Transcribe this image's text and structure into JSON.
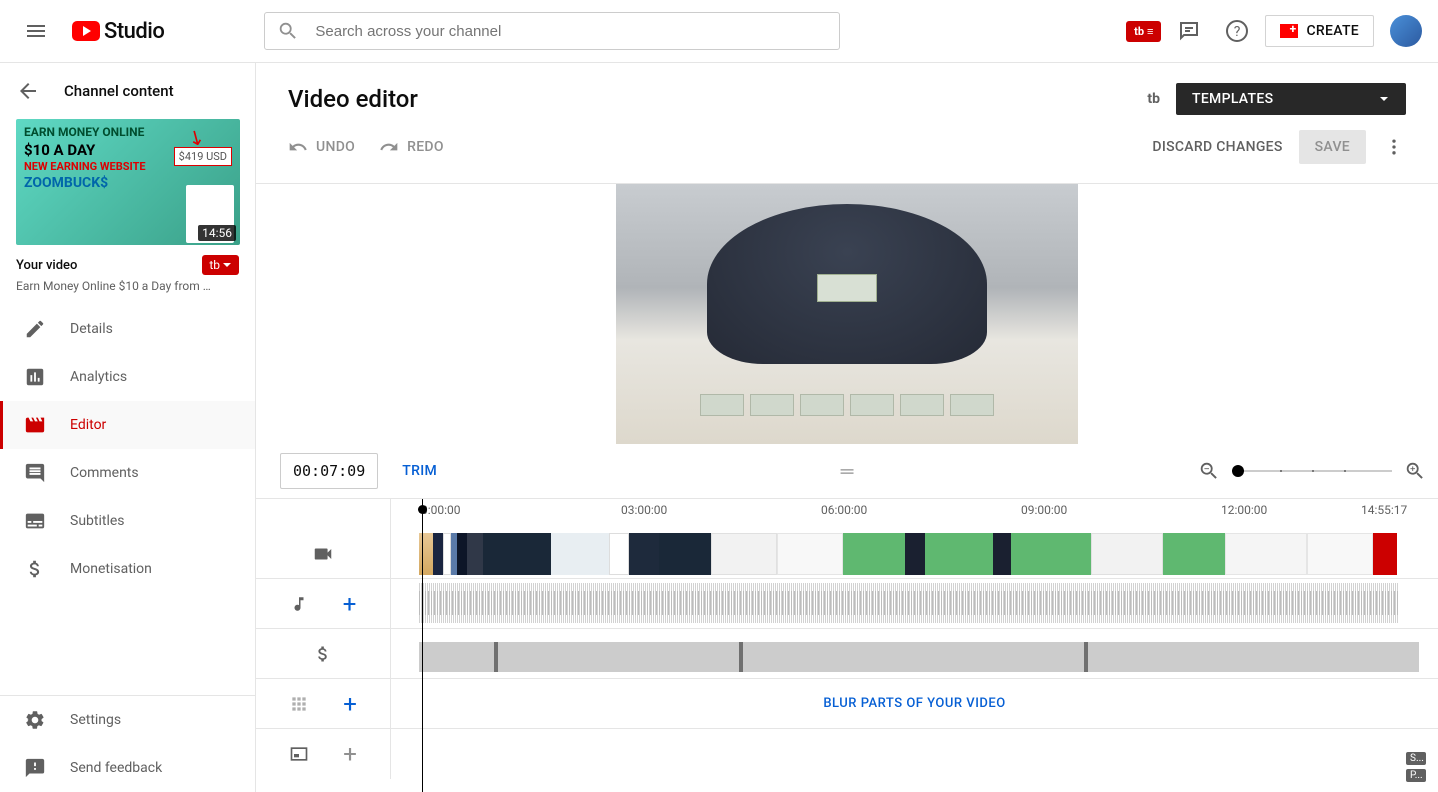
{
  "header": {
    "logo_text": "Studio",
    "search_placeholder": "Search across your channel",
    "create_label": "CREATE"
  },
  "sidebar": {
    "back_label": "Channel content",
    "thumb": {
      "line1": "EARN MONEY ONLINE",
      "line2": "$10 A DAY",
      "line3": "NEW EARNING WEBSITE",
      "line4": "ZOOMBUCK$",
      "price": "$419 USD",
      "duration": "14:56"
    },
    "video_title": "Your video",
    "video_subtitle": "Earn Money Online $10 a Day from …",
    "nav": [
      {
        "label": "Details"
      },
      {
        "label": "Analytics"
      },
      {
        "label": "Editor"
      },
      {
        "label": "Comments"
      },
      {
        "label": "Subtitles"
      },
      {
        "label": "Monetisation"
      }
    ],
    "settings_label": "Settings",
    "feedback_label": "Send feedback"
  },
  "main": {
    "title": "Video editor",
    "templates_label": "TEMPLATES",
    "undo": "UNDO",
    "redo": "REDO",
    "discard": "DISCARD CHANGES",
    "save": "SAVE"
  },
  "timeline": {
    "timecode": "00:07:09",
    "trim": "TRIM",
    "ruler": [
      "0:00:00",
      "03:00:00",
      "06:00:00",
      "09:00:00",
      "12:00:00",
      "14:55:17"
    ],
    "blur_label": "BLUR PARTS OF YOUR VIDEO",
    "badge_s": "S...",
    "badge_p": "P..."
  }
}
